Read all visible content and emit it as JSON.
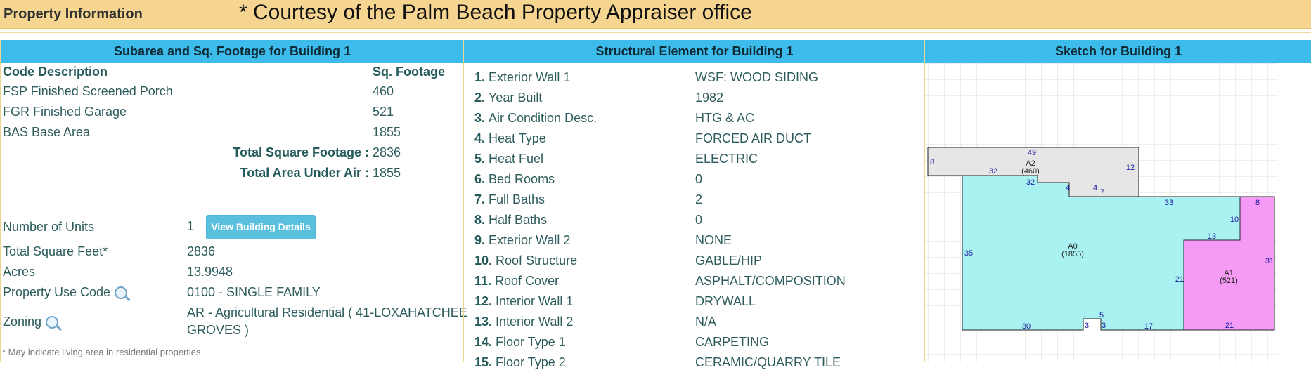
{
  "header": {
    "title": "Property Information",
    "courtesy": "* Courtesy of the Palm Beach Property Appraiser office"
  },
  "subarea": {
    "heading": "Subarea and Sq. Footage for Building 1",
    "col_code": "Code Description",
    "col_sqft": "Sq. Footage",
    "rows": [
      {
        "desc": "FSP Finished Screened Porch",
        "sqft": "460"
      },
      {
        "desc": "FGR Finished Garage",
        "sqft": "521"
      },
      {
        "desc": "BAS Base Area",
        "sqft": "1855"
      }
    ],
    "total_sqft_label": "Total Square Footage :",
    "total_sqft": "2836",
    "total_air_label": "Total Area Under Air :",
    "total_air": "1855"
  },
  "details": {
    "units_label": "Number of Units",
    "units_value": "1",
    "view_button": "View Building Details",
    "total_feet_label": "Total Square Feet*",
    "total_feet_value": "2836",
    "acres_label": "Acres",
    "acres_value": "13.9948",
    "use_code_label": "Property Use Code",
    "use_code_value": "0100 - SINGLE FAMILY",
    "zoning_label": "Zoning",
    "zoning_value_line1": "AR - Agricultural Residential ( 41-LOXAHATCHEE",
    "zoning_value_line2": "GROVES )",
    "footnote": "* May indicate living area in residential properties."
  },
  "structural": {
    "heading": "Structural Element for Building 1",
    "rows": [
      {
        "num": "1.",
        "label": "Exterior Wall 1",
        "value": "WSF: WOOD SIDING"
      },
      {
        "num": "2.",
        "label": "Year Built",
        "value": "1982"
      },
      {
        "num": "3.",
        "label": "Air Condition Desc.",
        "value": "HTG & AC"
      },
      {
        "num": "4.",
        "label": "Heat Type",
        "value": "FORCED AIR DUCT"
      },
      {
        "num": "5.",
        "label": "Heat Fuel",
        "value": "ELECTRIC"
      },
      {
        "num": "6.",
        "label": "Bed Rooms",
        "value": "0"
      },
      {
        "num": "7.",
        "label": "Full Baths",
        "value": "2"
      },
      {
        "num": "8.",
        "label": "Half Baths",
        "value": "0"
      },
      {
        "num": "9.",
        "label": "Exterior Wall 2",
        "value": "NONE"
      },
      {
        "num": "10.",
        "label": "Roof Structure",
        "value": "GABLE/HIP"
      },
      {
        "num": "11.",
        "label": "Roof Cover",
        "value": "ASPHALT/COMPOSITION"
      },
      {
        "num": "12.",
        "label": "Interior Wall 1",
        "value": "DRYWALL"
      },
      {
        "num": "13.",
        "label": "Interior Wall 2",
        "value": "N/A"
      },
      {
        "num": "14.",
        "label": "Floor Type 1",
        "value": "CARPETING"
      },
      {
        "num": "15.",
        "label": "Floor Type 2",
        "value": "CERAMIC/QUARRY TILE"
      }
    ]
  },
  "sketch": {
    "heading": "Sketch for Building 1",
    "areas": {
      "a2_code": "A2",
      "a2_sqft": "(460)",
      "a0_code": "A0",
      "a0_sqft": "(1855)",
      "a1_code": "A1",
      "a1_sqft": "(521)"
    },
    "dims": {
      "d49": "49",
      "d8a": "8",
      "d32a": "32",
      "d12": "12",
      "d32b": "32",
      "d4a": "4",
      "d4b": "4",
      "d7": "7",
      "d33": "33",
      "d8b": "8",
      "d10": "10",
      "d13": "13",
      "d35": "35",
      "d31": "31",
      "d21a": "21",
      "d5": "5",
      "d3a": "3",
      "d3b": "3",
      "d30": "30",
      "d17": "17",
      "d21b": "21"
    },
    "colors": {
      "a2_fill": "#e6e6e6",
      "a0_fill": "#aaf2f2",
      "a1_fill": "#f59af5"
    }
  }
}
